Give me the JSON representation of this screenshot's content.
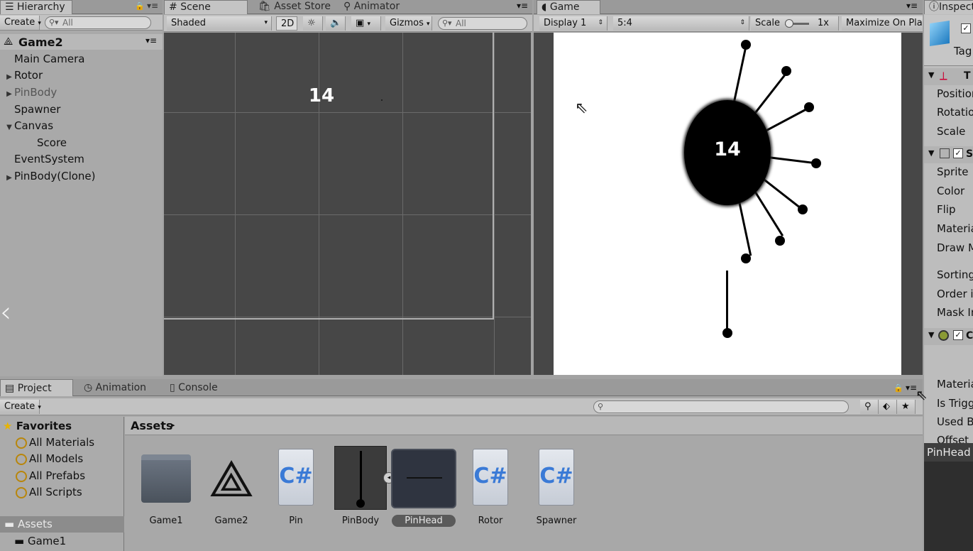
{
  "hierarchy": {
    "tab_label": "Hierarchy",
    "create_label": "Create",
    "search_placeholder": "All",
    "scene_name": "Game2",
    "items": [
      {
        "label": "Main Camera",
        "expandable": false
      },
      {
        "label": "Rotor",
        "expandable": true
      },
      {
        "label": "PinBody",
        "expandable": true
      },
      {
        "label": "Spawner",
        "expandable": false
      },
      {
        "label": "Canvas",
        "expandable": true
      },
      {
        "label": "Score",
        "expandable": false
      },
      {
        "label": "EventSystem",
        "expandable": false
      },
      {
        "label": "PinBody(Clone)",
        "expandable": true
      }
    ]
  },
  "scene": {
    "tabs": [
      "Scene",
      "Asset Store",
      "Animator"
    ],
    "shading": "Shaded",
    "mode_2d": "2D",
    "gizmos": "Gizmos",
    "search_placeholder": "All",
    "score_text": "14"
  },
  "game": {
    "tab_label": "Game",
    "display": "Display 1",
    "aspect": "5:4",
    "scale_label": "Scale",
    "scale_value": "1x",
    "maximize": "Maximize On Play",
    "score_text": "14"
  },
  "inspector": {
    "tab_label": "Inspector",
    "tag_label": "Tag",
    "transform_rows": [
      "Position",
      "Rotation",
      "Scale"
    ],
    "sprite_rows": [
      "Sprite",
      "Color",
      "Flip",
      "Material",
      "Draw Mode"
    ],
    "sorting_rows": [
      "Sorting",
      "Order in",
      "Mask In"
    ],
    "collider_rows": [
      "Material",
      "Is Trigger",
      "Used By",
      "Offset"
    ],
    "preview_label": "PinHead",
    "transform_short": "T",
    "sprite_short": "S",
    "collider_short": "C"
  },
  "bottom": {
    "tabs": [
      "Project",
      "Animation",
      "Console"
    ],
    "create_label": "Create",
    "favorites_label": "Favorites",
    "favorites": [
      "All Materials",
      "All Models",
      "All Prefabs",
      "All Scripts"
    ],
    "assets_label": "Assets",
    "tree_assets": "Assets",
    "tree_game1": "Game1",
    "assets": [
      "Game1",
      "Game2",
      "Pin",
      "PinBody",
      "PinHead",
      "Rotor",
      "Spawner"
    ],
    "cs_text": "C#"
  },
  "colors": {
    "editor_bg": "#a2a2a2",
    "scene_bg": "#474747",
    "game_bg": "#ffffff",
    "selected_asset": "#5a5a5a"
  }
}
